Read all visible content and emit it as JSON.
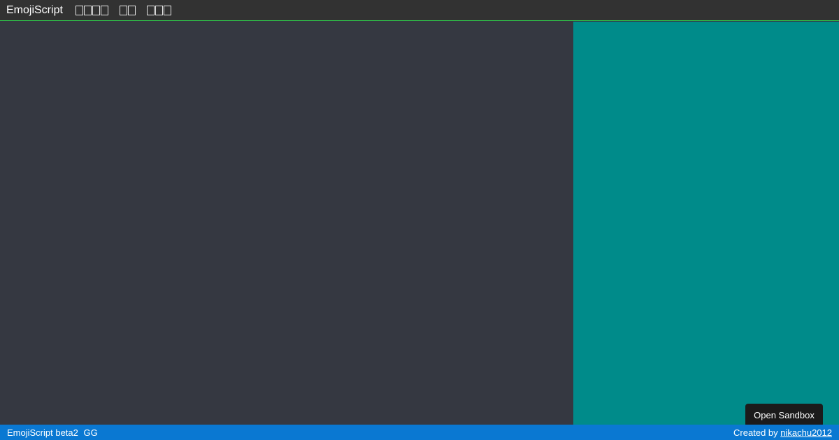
{
  "topbar": {
    "brand": "EmojiScript",
    "menu_items": [
      {
        "glyph_count": 4
      },
      {
        "glyph_count": 2
      },
      {
        "glyph_count": 3
      }
    ]
  },
  "sandbox_button": {
    "label": "Open Sandbox"
  },
  "statusbar": {
    "version": "EmojiScript beta2",
    "suffix": "GG",
    "credit_prefix": "Created by",
    "author": "nikachu2012"
  },
  "colors": {
    "topbar_bg": "#323232",
    "topbar_border": "#2fc24a",
    "editor_bg": "#353841",
    "output_bg": "#008b8a",
    "statusbar_bg": "#0a78d2",
    "button_bg": "#1b1b1b"
  }
}
